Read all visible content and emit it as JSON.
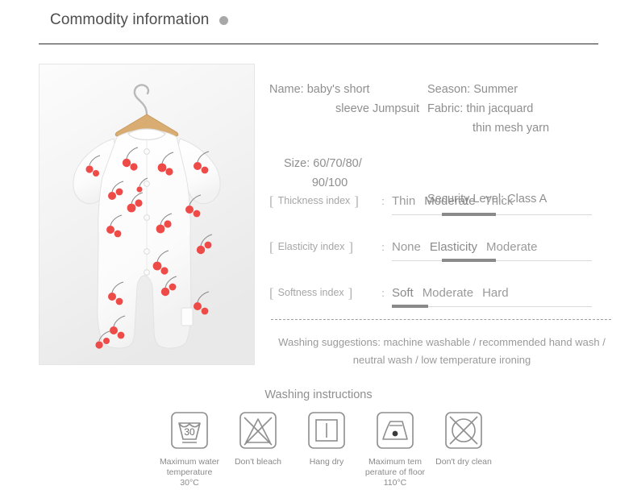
{
  "header": {
    "title": "Commodity information",
    "dot_icon": "status-dot",
    "rule_color": "#2b2b2b"
  },
  "photo": {
    "alt": "baby short sleeve jumpsuit with red cherry print on wooden hanger",
    "background_color": "#f2f2f2",
    "garment_color": "#ffffff",
    "print_color": "#ee4a48",
    "hanger_color": "#d9ad72"
  },
  "info": {
    "name_line_1": "Name: baby's short",
    "name_line_2": "sleeve Jumpsuit",
    "size_line_1": "Size: 60/70/80/",
    "size_line_2": "90/100",
    "season": "Season: Summer",
    "fabric_line_1": "Fabric: thin jacquard",
    "fabric_line_2": "thin mesh yarn",
    "security": "Security Level: Class A"
  },
  "indexes": [
    {
      "label": "Thickness index",
      "bracket_open": "[",
      "bracket_close": "]",
      "colon": ":",
      "options": [
        "Thin",
        "Moderate",
        "Thick"
      ],
      "selected": "Moderate"
    },
    {
      "label": "Elasticity index",
      "bracket_open": "[",
      "bracket_close": "]",
      "colon": ":",
      "options": [
        "None",
        "Elasticity",
        "Moderate"
      ],
      "selected": "Elasticity"
    },
    {
      "label": "Softness index",
      "bracket_open": "[",
      "bracket_close": "]",
      "colon": ":",
      "options": [
        "Soft",
        "Moderate",
        "Hard"
      ],
      "selected": "Soft"
    }
  ],
  "washing_suggestions": {
    "line_1": "Washing suggestions: machine washable / recommended hand wash /",
    "line_2": "neutral wash / low temperature ironing"
  },
  "washing_instructions": {
    "title": "Washing instructions",
    "items": [
      {
        "icon": "wash-tub-30-icon",
        "temperature": "30",
        "caption": "Maximum water\ntemperature 30°C"
      },
      {
        "icon": "no-bleach-triangle-icon",
        "caption": "Don't bleach"
      },
      {
        "icon": "hang-dry-icon",
        "caption": "Hang dry"
      },
      {
        "icon": "iron-one-dot-icon",
        "caption": "Maximum tem\nperature of floor 110°C"
      },
      {
        "icon": "no-dry-clean-icon",
        "caption": "Don't dry clean"
      }
    ]
  }
}
